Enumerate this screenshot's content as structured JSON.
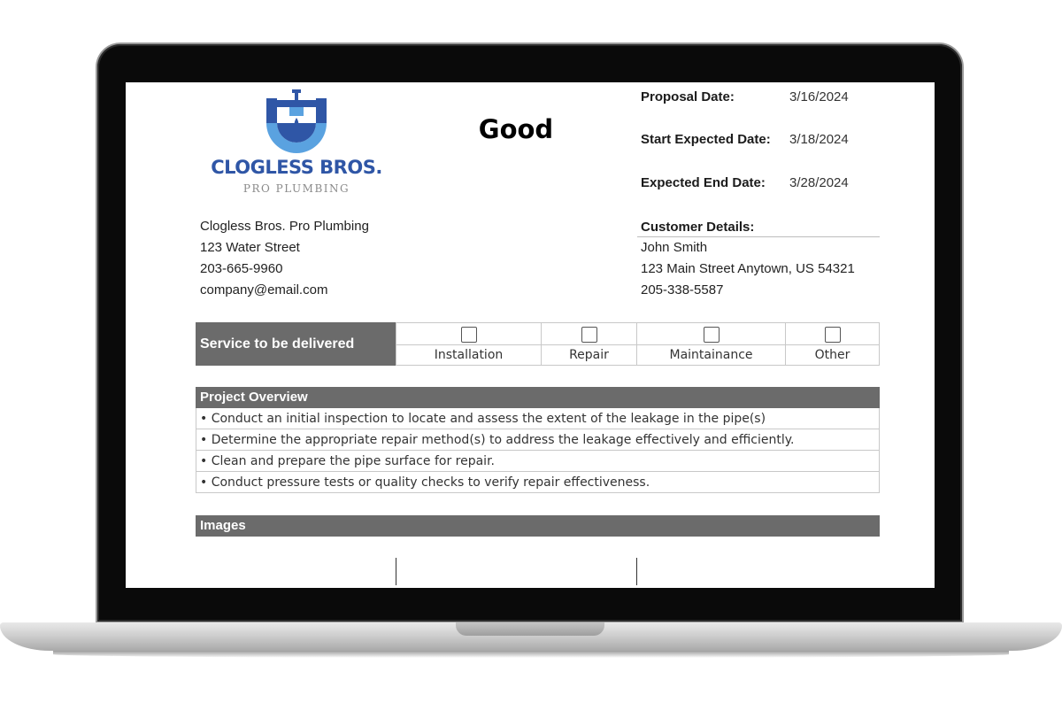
{
  "document": {
    "title": "Good",
    "logo": {
      "name": "CLOGLESS BROS.",
      "tagline": "PRO PLUMBING",
      "colors": {
        "primary": "#2f56a6",
        "light": "#5aa2e0"
      }
    },
    "dates": [
      {
        "label": "Proposal Date:",
        "value": "3/16/2024"
      },
      {
        "label": "Start Expected Date:",
        "value": "3/18/2024"
      },
      {
        "label": "Expected End Date:",
        "value": "3/28/2024"
      }
    ],
    "company": {
      "name": "Clogless Bros. Pro Plumbing",
      "street": "123 Water Street",
      "phone": "203-665-9960",
      "email": "company@email.com"
    },
    "customer": {
      "heading": "Customer Details:",
      "name": "John Smith",
      "address": "123 Main Street Anytown, US 54321",
      "phone": "205-338-5587"
    },
    "services": {
      "label": "Service to be delivered",
      "options": [
        {
          "label": "Installation",
          "checked": false
        },
        {
          "label": "Repair",
          "checked": false
        },
        {
          "label": "Maintainance",
          "checked": false
        },
        {
          "label": "Other",
          "checked": false
        }
      ]
    },
    "overview": {
      "heading": "Project Overview",
      "items": [
        "• Conduct an initial inspection to locate and assess the extent of the leakage in the pipe(s)",
        "• Determine the appropriate repair method(s) to address the leakage effectively and efficiently.",
        "• Clean and prepare the pipe surface for repair.",
        "• Conduct pressure tests or quality checks to verify repair effectiveness."
      ]
    },
    "images": {
      "heading": "Images"
    },
    "colors": {
      "section_bar": "#6b6b6b",
      "border": "#c8c8c8"
    }
  }
}
